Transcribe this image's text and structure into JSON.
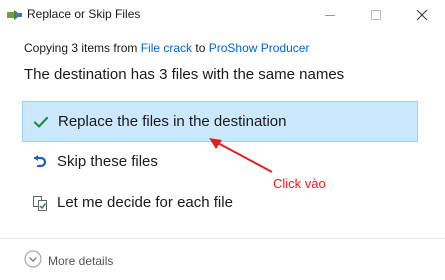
{
  "window": {
    "title": "Replace or Skip Files",
    "icon": "file-copy-icon",
    "controls": [
      "minimize-icon",
      "maximize-icon",
      "close-icon"
    ]
  },
  "copy_status": {
    "prefix": "Copying 3 items from ",
    "source": "File crack",
    "middle": " to ",
    "destination": "ProShow Producer"
  },
  "heading": "The destination has 3 files with the same names",
  "options": [
    {
      "label": "Replace the files in the destination",
      "icon": "checkmark-icon",
      "selected": true
    },
    {
      "label": "Skip these files",
      "icon": "skip-arrow-icon",
      "selected": false
    },
    {
      "label": "Let me decide for each file",
      "icon": "compare-files-icon",
      "selected": false
    }
  ],
  "annotation": "Click vào",
  "footer": {
    "more_details": "More details"
  },
  "colors": {
    "accent_link": "#0066cc",
    "selection_bg": "#cce8ff",
    "selection_border": "#99d1ff",
    "annotation": "#e02020",
    "check": "#2a8a3e"
  }
}
